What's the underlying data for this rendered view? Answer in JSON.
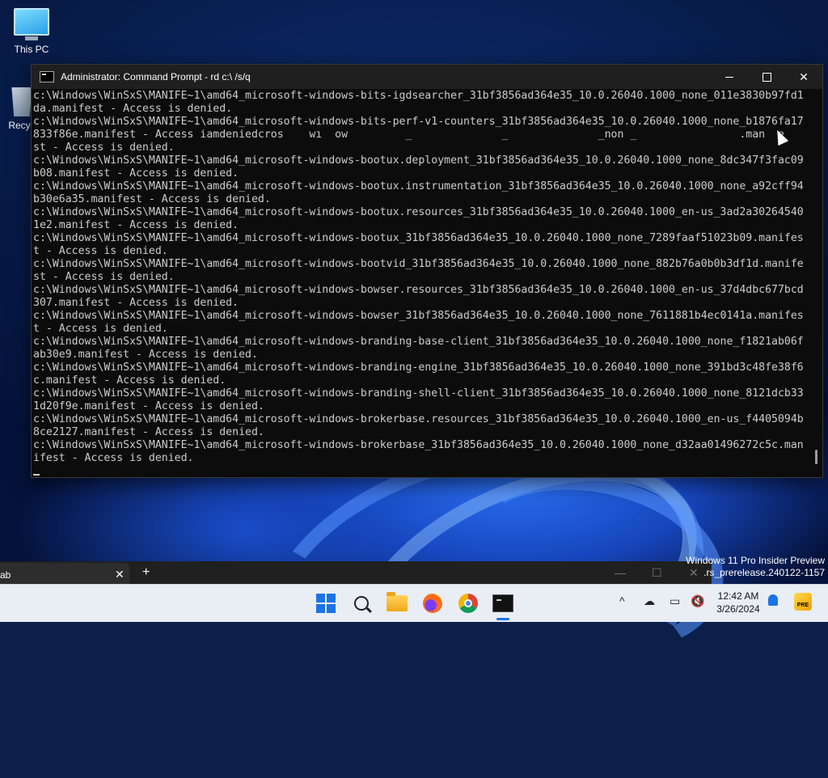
{
  "desktop": {
    "icons": [
      {
        "label": "This PC"
      },
      {
        "label": "Recyc"
      }
    ]
  },
  "cmd": {
    "title": "Administrator: Command Prompt - rd  c:\\ /s/q",
    "lines": [
      "c:\\Windows\\WinSxS\\MANIFE~1\\amd64_microsoft-windows-bits-igdsearcher_31bf3856ad364e35_10.0.26040.1000_none_011e3830b97fd1",
      "da.manifest - Access is denied.",
      "c:\\Windows\\WinSxS\\MANIFE~1\\amd64_microsoft-windows-bits-perf-v1-counters_31bf3856ad364e35_10.0.26040.1000_none_b1876fa17",
      "833f86e.manifest - Access iamdeniedcros    wı  ow         _              _              _non _                .man  e",
      "st - Access is denied.",
      "c:\\Windows\\WinSxS\\MANIFE~1\\amd64_microsoft-windows-bootux.deployment_31bf3856ad364e35_10.0.26040.1000_none_8dc347f3fac09",
      "b08.manifest - Access is denied.",
      "c:\\Windows\\WinSxS\\MANIFE~1\\amd64_microsoft-windows-bootux.instrumentation_31bf3856ad364e35_10.0.26040.1000_none_a92cff94",
      "b30e6a35.manifest - Access is denied.",
      "c:\\Windows\\WinSxS\\MANIFE~1\\amd64_microsoft-windows-bootux.resources_31bf3856ad364e35_10.0.26040.1000_en-us_3ad2a30264540",
      "1e2.manifest - Access is denied.",
      "c:\\Windows\\WinSxS\\MANIFE~1\\amd64_microsoft-windows-bootux_31bf3856ad364e35_10.0.26040.1000_none_7289faaf51023b09.manifes",
      "t - Access is denied.",
      "c:\\Windows\\WinSxS\\MANIFE~1\\amd64_microsoft-windows-bootvid_31bf3856ad364e35_10.0.26040.1000_none_882b76a0b0b3df1d.manife",
      "st - Access is denied.",
      "c:\\Windows\\WinSxS\\MANIFE~1\\amd64_microsoft-windows-bowser.resources_31bf3856ad364e35_10.0.26040.1000_en-us_37d4dbc677bcd",
      "307.manifest - Access is denied.",
      "c:\\Windows\\WinSxS\\MANIFE~1\\amd64_microsoft-windows-bowser_31bf3856ad364e35_10.0.26040.1000_none_7611881b4ec0141a.manifes",
      "t - Access is denied.",
      "c:\\Windows\\WinSxS\\MANIFE~1\\amd64_microsoft-windows-branding-base-client_31bf3856ad364e35_10.0.26040.1000_none_f1821ab06f",
      "ab30e9.manifest - Access is denied.",
      "c:\\Windows\\WinSxS\\MANIFE~1\\amd64_microsoft-windows-branding-engine_31bf3856ad364e35_10.0.26040.1000_none_391bd3c48fe38f6",
      "c.manifest - Access is denied.",
      "c:\\Windows\\WinSxS\\MANIFE~1\\amd64_microsoft-windows-branding-shell-client_31bf3856ad364e35_10.0.26040.1000_none_8121dcb33",
      "1d20f9e.manifest - Access is denied.",
      "c:\\Windows\\WinSxS\\MANIFE~1\\amd64_microsoft-windows-brokerbase.resources_31bf3856ad364e35_10.0.26040.1000_en-us_f4405094b",
      "8ce2127.manifest - Access is denied.",
      "c:\\Windows\\WinSxS\\MANIFE~1\\amd64_microsoft-windows-brokerbase_31bf3856ad364e35_10.0.26040.1000_none_d32aa01496272c5c.man",
      "ifest - Access is denied."
    ]
  },
  "bg_window": {
    "tab_label": "ab",
    "tab_close": "✕",
    "new_tab": "+",
    "minimize": "—",
    "maximize": "☐",
    "close": "✕"
  },
  "watermark": {
    "line1": "Windows 11 Pro Insider Preview",
    "line2": ".rs_prerelease.240122-1157"
  },
  "taskbar": {
    "time": "12:42 AM",
    "date": "3/26/2024",
    "tray_overflow": "^",
    "pre_badge": "PRE",
    "accent": "#1a73e8"
  }
}
